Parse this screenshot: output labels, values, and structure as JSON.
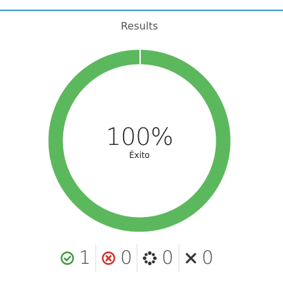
{
  "panel": {
    "title": "Results"
  },
  "result": {
    "success_percent": 100,
    "percent_label": "100%",
    "status_label": "Éxito"
  },
  "stats": {
    "passed": {
      "icon": "check-circle-icon",
      "count": "1",
      "color": "#3f9a3f"
    },
    "failed": {
      "icon": "x-circle-icon",
      "count": "0",
      "color": "#d0322d"
    },
    "pending": {
      "icon": "spinner-icon",
      "count": "0",
      "color": "#333333"
    },
    "skipped": {
      "icon": "x-icon",
      "count": "0",
      "color": "#333333"
    }
  },
  "colors": {
    "accent_border": "#3a9bc9",
    "ring": "#5cb85c"
  }
}
